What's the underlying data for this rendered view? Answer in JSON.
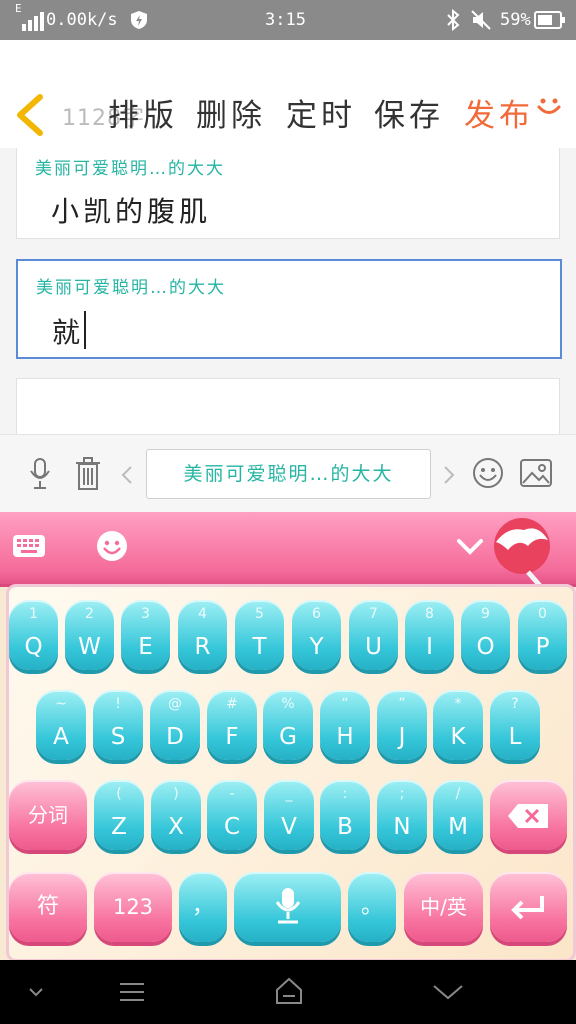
{
  "status": {
    "signal": "E",
    "speed": "0.00k/s",
    "time": "3:15",
    "battery_pct": "59%"
  },
  "toolbar": {
    "count": "1128字",
    "format_label": "排版",
    "delete_label": "删除",
    "timer_label": "定时",
    "save_label": "保存",
    "publish_label": "发布"
  },
  "posts": [
    {
      "author": "美丽可爱聪明…的大大",
      "text": "小凯的腹肌"
    },
    {
      "author": "美丽可爱聪明…的大大",
      "text": "就"
    }
  ],
  "actionbar": {
    "signature": "美丽可爱聪明…的大大"
  },
  "keyboard": {
    "row1": [
      {
        "main": "Q",
        "sub": "1"
      },
      {
        "main": "W",
        "sub": "2"
      },
      {
        "main": "E",
        "sub": "3"
      },
      {
        "main": "R",
        "sub": "4"
      },
      {
        "main": "T",
        "sub": "5"
      },
      {
        "main": "Y",
        "sub": "6"
      },
      {
        "main": "U",
        "sub": "7"
      },
      {
        "main": "I",
        "sub": "8"
      },
      {
        "main": "O",
        "sub": "9"
      },
      {
        "main": "P",
        "sub": "0"
      }
    ],
    "row2": [
      {
        "main": "A",
        "sub": "~"
      },
      {
        "main": "S",
        "sub": "!"
      },
      {
        "main": "D",
        "sub": "@"
      },
      {
        "main": "F",
        "sub": "#"
      },
      {
        "main": "G",
        "sub": "%"
      },
      {
        "main": "H",
        "sub": "“"
      },
      {
        "main": "J",
        "sub": "”"
      },
      {
        "main": "K",
        "sub": "*"
      },
      {
        "main": "L",
        "sub": "?"
      }
    ],
    "row3": [
      {
        "main": "Z",
        "sub": "("
      },
      {
        "main": "X",
        "sub": ")"
      },
      {
        "main": "C",
        "sub": "-"
      },
      {
        "main": "V",
        "sub": "_"
      },
      {
        "main": "B",
        "sub": ":"
      },
      {
        "main": "N",
        "sub": ";"
      },
      {
        "main": "M",
        "sub": "/"
      }
    ],
    "segment_label": "分词",
    "symbol_label": "符",
    "num_label": "123",
    "comma_label": "，",
    "period_label": "。",
    "lang_label": "中/英"
  },
  "colors": {
    "accent": "#26b5a3",
    "publish": "#f26a3a",
    "key_blue": "#35c6d9",
    "key_pink": "#f7729f"
  }
}
